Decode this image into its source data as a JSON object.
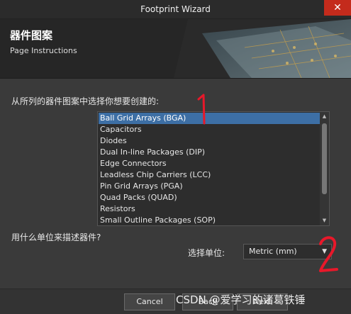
{
  "window": {
    "title": "Footprint Wizard",
    "close_glyph": "✕"
  },
  "header": {
    "title": "器件图案",
    "subtitle": "Page Instructions"
  },
  "prompt": "从所列的器件图案中选择你想要创建的:",
  "list": {
    "items": [
      "Ball Grid Arrays (BGA)",
      "Capacitors",
      "Diodes",
      "Dual In-line Packages (DIP)",
      "Edge Connectors",
      "Leadless Chip Carriers (LCC)",
      "Pin Grid Arrays (PGA)",
      "Quad Packs (QUAD)",
      "Resistors",
      "Small Outline Packages (SOP)"
    ],
    "selected": "Ball Grid Arrays (BGA)"
  },
  "units": {
    "question": "用什么单位来描述器件?",
    "label": "选择单位:",
    "selected": "Metric (mm)"
  },
  "buttons": {
    "cancel": "Cancel",
    "back": "Back",
    "next": "Next"
  },
  "annotations": {
    "one": "1",
    "two": "2"
  },
  "watermark": "CSDN @爱学习的诸葛铁锤",
  "colors": {
    "selection": "#3d6fa5",
    "annotation": "#e8182a",
    "close": "#c42b1c"
  }
}
